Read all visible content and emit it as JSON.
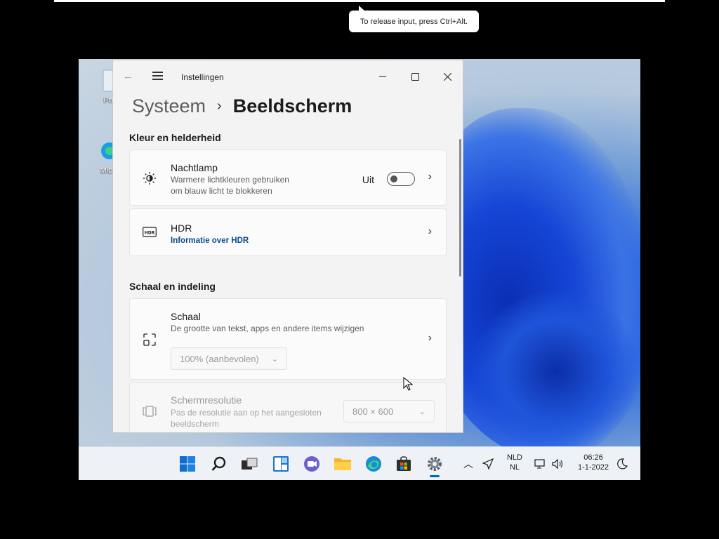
{
  "tooltip": "To release input, press Ctrl+Alt.",
  "desktop": {
    "icon1": "Pru",
    "icon2": "Micro"
  },
  "window": {
    "app_title": "Instellingen",
    "breadcrumb": {
      "parent": "Systeem",
      "current": "Beeldscherm"
    },
    "sections": {
      "color": "Kleur en helderheid",
      "scale": "Schaal en indeling"
    },
    "night_light": {
      "title": "Nachtlamp",
      "desc_line1": "Warmere lichtkleuren gebruiken",
      "desc_line2": "om blauw licht te blokkeren",
      "state": "Uit",
      "enabled": false
    },
    "hdr": {
      "title": "HDR",
      "link": "Informatie over HDR",
      "badge": "HDR"
    },
    "scale": {
      "title": "Schaal",
      "desc": "De grootte van tekst, apps en andere items wijzigen",
      "value": "100% (aanbevolen)"
    },
    "resolution": {
      "title": "Schermresolutie",
      "desc_line1": "Pas de resolutie aan op het aangesloten",
      "desc_line2": "beeldscherm",
      "value": "800 × 600"
    }
  },
  "taskbar": {
    "lang_top": "NLD",
    "lang_bottom": "NL",
    "time": "06:26",
    "date": "1-1-2022"
  },
  "colors": {
    "accent": "#0067c0",
    "link": "#0a4a8f",
    "window_bg": "#f3f3f3"
  }
}
